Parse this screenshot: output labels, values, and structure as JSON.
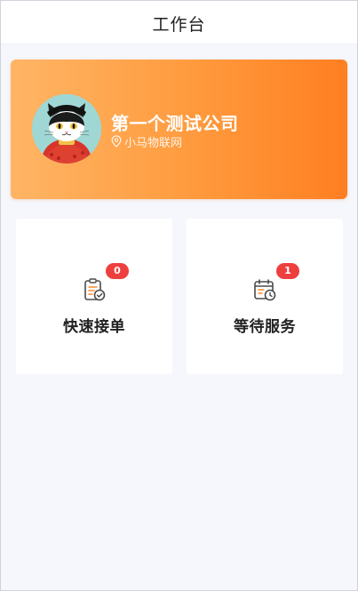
{
  "header": {
    "title": "工作台"
  },
  "company": {
    "name": "第一个测试公司",
    "location": "小马物联网",
    "location_icon": "map-pin-icon",
    "avatar": "cat-avatar"
  },
  "cards": [
    {
      "label": "快速接单",
      "badge": "0",
      "icon": "clipboard-check-icon"
    },
    {
      "label": "等待服务",
      "badge": "1",
      "icon": "calendar-clock-icon"
    }
  ],
  "colors": {
    "banner_start": "#ffb565",
    "banner_end": "#ff7f22",
    "badge": "#ee3f3f",
    "icon_dark": "#4a4a4a",
    "icon_accent": "#ff8a2a",
    "page_bg": "#f5f7fc"
  }
}
